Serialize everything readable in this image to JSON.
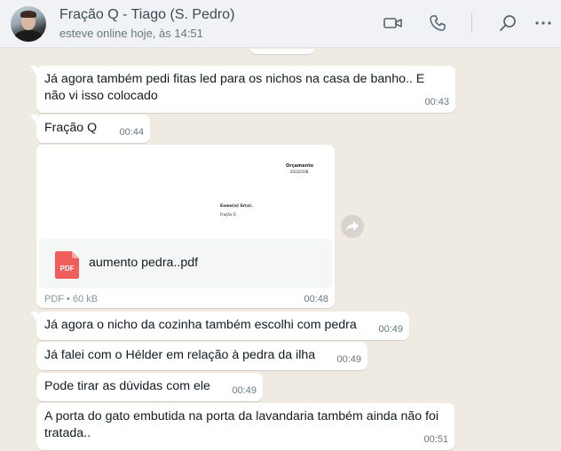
{
  "header": {
    "contact_name": "Fração Q - Tiago (S. Pedro)",
    "status": "esteve online hoje, às 14:51",
    "icons": [
      "video-call-icon",
      "voice-call-icon",
      "search-icon",
      "menu-icon"
    ]
  },
  "messages": [
    {
      "text": "Já agora também pedi fitas led para os nichos na casa de banho.. E não vi isso colocado",
      "time": "00:43"
    },
    {
      "text": "Fração Q",
      "time": "00:44"
    },
    {
      "text": "Já agora o nicho da cozinha também escolhi com pedra",
      "time": "00:49"
    },
    {
      "text": "Já falei com o Hélder em relação à pedra da ilha",
      "time": "00:49"
    },
    {
      "text": "Pode tirar as dúvidas com ele",
      "time": "00:49"
    },
    {
      "text": "A porta do gato embutida na porta da lavandaria também ainda não foi tratada..",
      "time": "00:51"
    }
  ],
  "document": {
    "preview_title": "Orçamento",
    "preview_number": "20220108",
    "preview_greeting": "Exmo(a) Sr(a).",
    "preview_recipient": "Fração Q",
    "icon_label": "PDF",
    "file_name": "aumento pedra..pdf",
    "meta": "PDF • 60 kB",
    "time": "00:48"
  },
  "colors": {
    "chat_background": "#efeae2",
    "bubble": "#ffffff",
    "pdf_red": "#f15c5c"
  }
}
